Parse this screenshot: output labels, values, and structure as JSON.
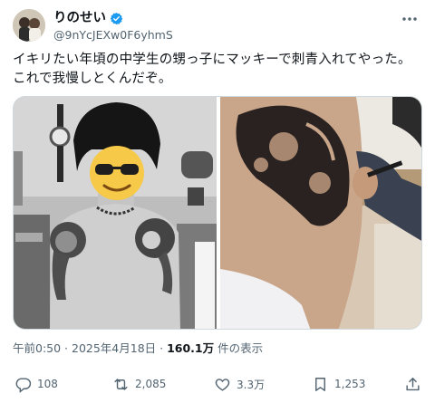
{
  "user": {
    "display_name": "りのせい",
    "handle": "@9nYcJEXw0F6yhmS",
    "verified": true
  },
  "tweet": {
    "text": "イキリたい年頃の中学生の甥っ子にマッキーで刺青入れてやった。これで我慢しとくんだぞ。"
  },
  "meta": {
    "time": "午前0:50",
    "separator": " · ",
    "date": "2025年4月18日",
    "views_count": "160.1万",
    "views_label": "件の表示"
  },
  "actions": {
    "replies": "108",
    "reposts": "2,085",
    "likes": "3.3万",
    "bookmarks": "1,253"
  },
  "icons": [
    "verified-badge-icon",
    "more-icon",
    "reply-icon",
    "repost-icon",
    "like-icon",
    "bookmark-icon",
    "share-icon"
  ],
  "colors": {
    "verified": "#1d9bf0",
    "muted": "#536471",
    "text": "#0f1419"
  }
}
